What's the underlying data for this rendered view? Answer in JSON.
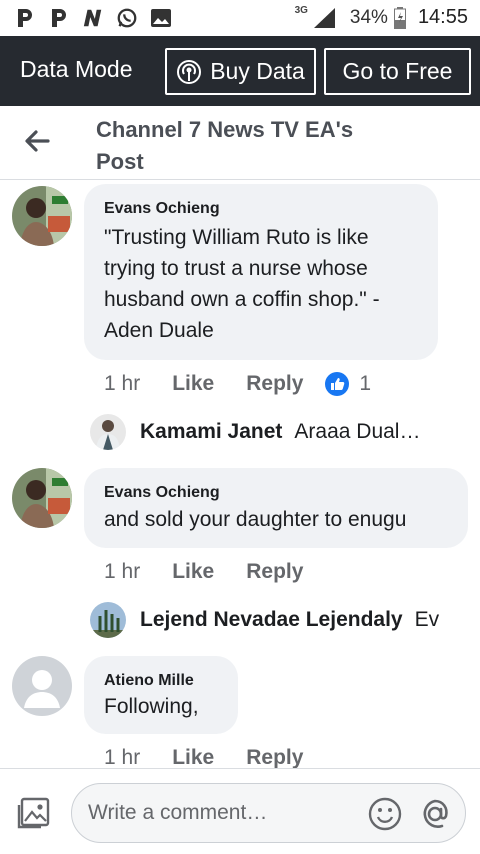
{
  "status_bar": {
    "left_icons": [
      "p-notification-icon",
      "p-notification-icon",
      "n-notification-icon",
      "whatsapp-icon",
      "gallery-icon"
    ],
    "network": "3G",
    "battery": "34%",
    "time": "14:55"
  },
  "data_bar": {
    "label": "Data Mode",
    "buy_label": "Buy Data",
    "free_label": "Go to Free"
  },
  "header": {
    "title": "Channel 7 News TV EA's Post"
  },
  "comments": [
    {
      "author": "Evans Ochieng",
      "text": "\"Trusting William Ruto is like trying to trust a nurse whose husband own a coffin shop.\" - Aden Duale",
      "time": "1 hr",
      "like": "Like",
      "reply": "Reply",
      "reactions": "1",
      "reply_preview": {
        "author": "Kamami Janet",
        "text": "Araaa Dual…"
      }
    },
    {
      "author": "Evans Ochieng",
      "text": "and sold your daughter to enugu",
      "time": "1 hr",
      "like": "Like",
      "reply": "Reply",
      "reply_preview": {
        "author": "Lejend Nevadae Lejendaly",
        "text": "Ev"
      }
    },
    {
      "author": "Atieno Mille",
      "text": "Following,",
      "time": "1 hr",
      "like": "Like",
      "reply": "Reply"
    }
  ],
  "composer": {
    "placeholder": "Write a comment…"
  },
  "colors": {
    "data_bar_bg": "#262a30",
    "bubble_bg": "#f0f2f5",
    "like_blue": "#1877f2"
  }
}
